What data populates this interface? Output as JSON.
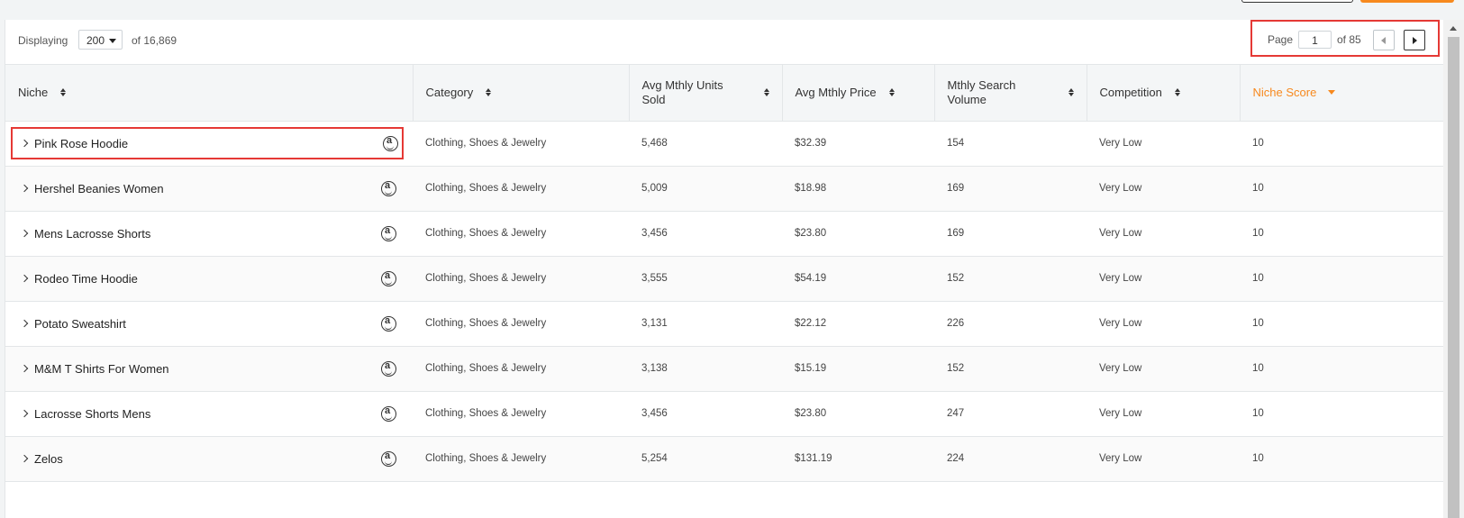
{
  "toolbar": {
    "displaying_label": "Displaying",
    "page_size": "200",
    "total_text": "of 16,869"
  },
  "pager": {
    "page_label": "Page",
    "current_page": "1",
    "total_pages_text": "of 85"
  },
  "columns": [
    {
      "label": "Niche"
    },
    {
      "label": "Category"
    },
    {
      "label": "Avg Mthly Units Sold"
    },
    {
      "label": "Avg Mthly Price"
    },
    {
      "label": "Mthly Search Volume"
    },
    {
      "label": "Competition"
    },
    {
      "label": "Niche Score"
    }
  ],
  "sort": {
    "column": "Niche Score",
    "direction": "desc",
    "accent_color": "#f7891e"
  },
  "rows": [
    {
      "niche": "Pink Rose Hoodie",
      "category": "Clothing, Shoes & Jewelry",
      "units": "5,468",
      "price": "$32.39",
      "search": "154",
      "competition": "Very Low",
      "score": "10"
    },
    {
      "niche": "Hershel Beanies Women",
      "category": "Clothing, Shoes & Jewelry",
      "units": "5,009",
      "price": "$18.98",
      "search": "169",
      "competition": "Very Low",
      "score": "10"
    },
    {
      "niche": "Mens Lacrosse Shorts",
      "category": "Clothing, Shoes & Jewelry",
      "units": "3,456",
      "price": "$23.80",
      "search": "169",
      "competition": "Very Low",
      "score": "10"
    },
    {
      "niche": "Rodeo Time Hoodie",
      "category": "Clothing, Shoes & Jewelry",
      "units": "3,555",
      "price": "$54.19",
      "search": "152",
      "competition": "Very Low",
      "score": "10"
    },
    {
      "niche": "Potato Sweatshirt",
      "category": "Clothing, Shoes & Jewelry",
      "units": "3,131",
      "price": "$22.12",
      "search": "226",
      "competition": "Very Low",
      "score": "10"
    },
    {
      "niche": "M&M T Shirts For Women",
      "category": "Clothing, Shoes & Jewelry",
      "units": "3,138",
      "price": "$15.19",
      "search": "152",
      "competition": "Very Low",
      "score": "10"
    },
    {
      "niche": "Lacrosse Shorts Mens",
      "category": "Clothing, Shoes & Jewelry",
      "units": "3,456",
      "price": "$23.80",
      "search": "247",
      "competition": "Very Low",
      "score": "10"
    },
    {
      "niche": "Zelos",
      "category": "Clothing, Shoes & Jewelry",
      "units": "5,254",
      "price": "$131.19",
      "search": "224",
      "competition": "Very Low",
      "score": "10"
    }
  ],
  "row_icon": "amazon-icon",
  "highlight_color": "#e53935"
}
